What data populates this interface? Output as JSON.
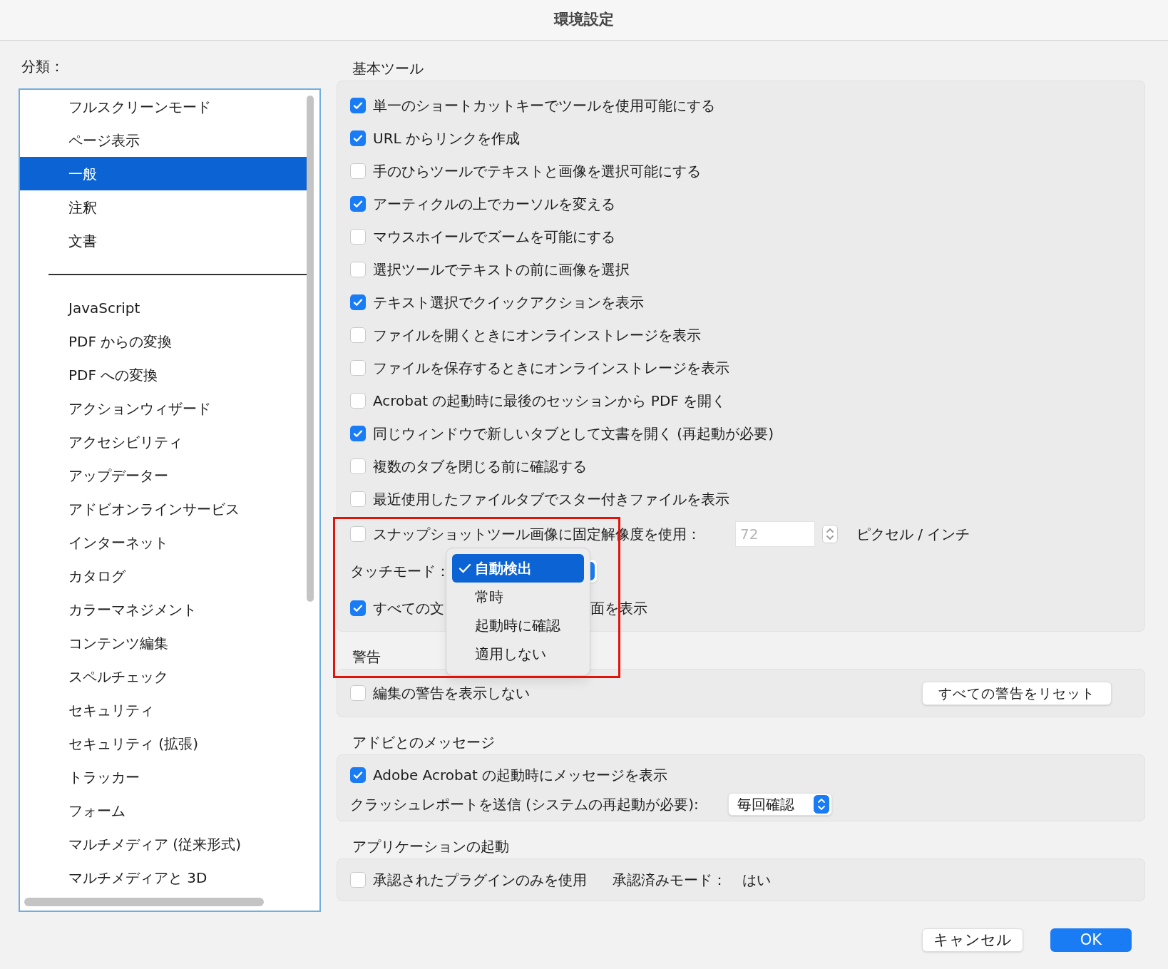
{
  "window": {
    "title": "環境設定"
  },
  "sidebar": {
    "label": "分類：",
    "groups": [
      {
        "items": [
          {
            "label": "フルスクリーンモード",
            "selected": false
          },
          {
            "label": "ページ表示",
            "selected": false
          },
          {
            "label": "一般",
            "selected": true
          },
          {
            "label": "注釈",
            "selected": false
          },
          {
            "label": "文書",
            "selected": false
          }
        ]
      },
      {
        "items": [
          {
            "label": "JavaScript",
            "selected": false
          },
          {
            "label": "PDF からの変換",
            "selected": false
          },
          {
            "label": "PDF への変換",
            "selected": false
          },
          {
            "label": "アクションウィザード",
            "selected": false
          },
          {
            "label": "アクセシビリティ",
            "selected": false
          },
          {
            "label": "アップデーター",
            "selected": false
          },
          {
            "label": "アドビオンラインサービス",
            "selected": false
          },
          {
            "label": "インターネット",
            "selected": false
          },
          {
            "label": "カタログ",
            "selected": false
          },
          {
            "label": "カラーマネジメント",
            "selected": false
          },
          {
            "label": "コンテンツ編集",
            "selected": false
          },
          {
            "label": "スペルチェック",
            "selected": false
          },
          {
            "label": "セキュリティ",
            "selected": false
          },
          {
            "label": "セキュリティ (拡張)",
            "selected": false
          },
          {
            "label": "トラッカー",
            "selected": false
          },
          {
            "label": "フォーム",
            "selected": false
          },
          {
            "label": "マルチメディア (従来形式)",
            "selected": false
          },
          {
            "label": "マルチメディアと 3D",
            "selected": false
          }
        ]
      }
    ]
  },
  "sections": [
    {
      "title": "基本ツール",
      "rows": [
        {
          "kind": "checkbox",
          "label": "単一のショートカットキーでツールを使用可能にする",
          "checked": true
        },
        {
          "kind": "checkbox",
          "label": "URL からリンクを作成",
          "checked": true
        },
        {
          "kind": "checkbox",
          "label": "手のひらツールでテキストと画像を選択可能にする",
          "checked": false
        },
        {
          "kind": "checkbox",
          "label": "アーティクルの上でカーソルを変える",
          "checked": true
        },
        {
          "kind": "checkbox",
          "label": "マウスホイールでズームを可能にする",
          "checked": false
        },
        {
          "kind": "checkbox",
          "label": "選択ツールでテキストの前に画像を選択",
          "checked": false
        },
        {
          "kind": "checkbox",
          "label": "テキスト選択でクイックアクションを表示",
          "checked": true
        },
        {
          "kind": "checkbox",
          "label": "ファイルを開くときにオンラインストレージを表示",
          "checked": false
        },
        {
          "kind": "checkbox",
          "label": "ファイルを保存するときにオンラインストレージを表示",
          "checked": false
        },
        {
          "kind": "checkbox",
          "label": "Acrobat の起動時に最後のセッションから PDF を開く",
          "checked": false
        },
        {
          "kind": "checkbox",
          "label": "同じウィンドウで新しいタブとして文書を開く (再起動が必要)",
          "checked": true
        },
        {
          "kind": "checkbox",
          "label": "複数のタブを閉じる前に確認する",
          "checked": false
        },
        {
          "kind": "checkbox",
          "label": "最近使用したファイルタブでスター付きファイルを表示",
          "checked": false
        },
        {
          "kind": "number",
          "label": "スナップショットツール画像に固定解像度を使用：",
          "checked": false,
          "value": "72",
          "disabled": true,
          "unit": "ピクセル / インチ"
        },
        {
          "kind": "touch",
          "label": "タッチモード："
        },
        {
          "kind": "split",
          "label_start": "すべての文",
          "label_end": "面を表示",
          "checked": true
        }
      ]
    },
    {
      "title": "警告",
      "rows": [
        {
          "kind": "checkbutton",
          "label": "編集の警告を表示しない",
          "checked": false,
          "button": "すべての警告をリセット"
        }
      ]
    },
    {
      "title": "アドビとのメッセージ",
      "rows": [
        {
          "kind": "checkbox",
          "label": "Adobe Acrobat の起動時にメッセージを表示",
          "checked": true
        },
        {
          "kind": "select",
          "label": "クラッシュレポートを送信 (システムの再起動が必要):",
          "value": "毎回確認"
        }
      ]
    },
    {
      "title": "アプリケーションの起動",
      "rows": [
        {
          "kind": "pair",
          "label": "承認されたプラグインのみを使用",
          "checked": false,
          "extra_label": "承認済みモード：",
          "extra_value": "はい"
        }
      ]
    }
  ],
  "touch_menu": {
    "options": [
      {
        "label": "自動検出",
        "selected": true
      },
      {
        "label": "常時",
        "selected": false
      },
      {
        "label": "起動時に確認",
        "selected": false
      },
      {
        "label": "適用しない",
        "selected": false
      }
    ]
  },
  "buttons": [
    {
      "label": "キャンセル",
      "kind": "secondary"
    },
    {
      "label": "OK",
      "kind": "primary"
    }
  ]
}
